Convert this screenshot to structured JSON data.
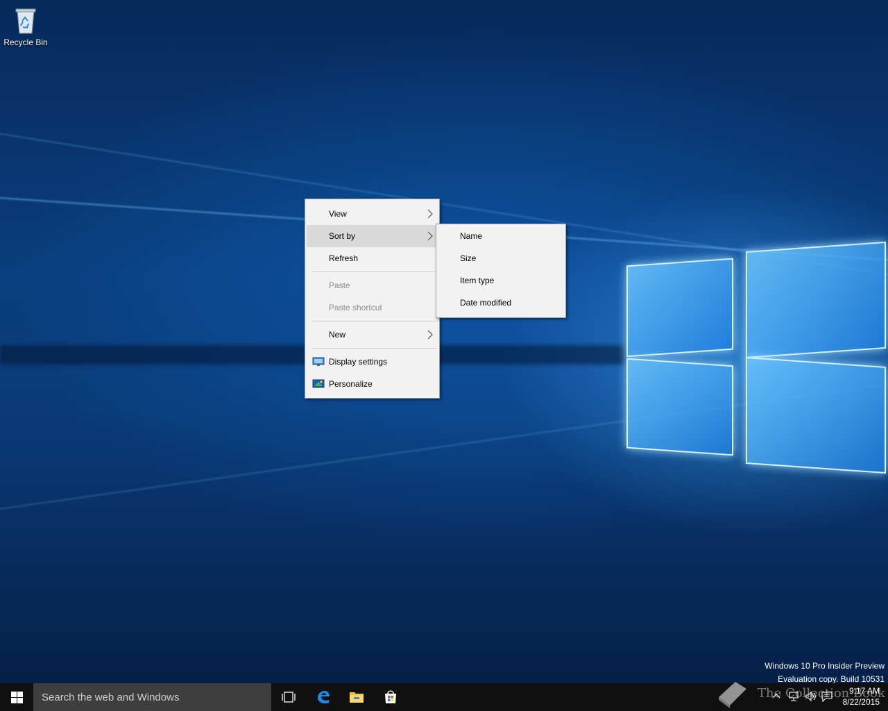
{
  "desktop": {
    "icons": [
      {
        "label": "Recycle Bin",
        "icon": "recycle-bin-icon"
      }
    ]
  },
  "context_menu": {
    "items": [
      {
        "label": "View",
        "submenu": true,
        "state": "normal"
      },
      {
        "label": "Sort by",
        "submenu": true,
        "state": "highlighted"
      },
      {
        "label": "Refresh",
        "submenu": false,
        "state": "normal"
      },
      {
        "label": "Paste",
        "submenu": false,
        "state": "disabled"
      },
      {
        "label": "Paste shortcut",
        "submenu": false,
        "state": "disabled"
      },
      {
        "label": "New",
        "submenu": true,
        "state": "normal"
      },
      {
        "label": "Display settings",
        "icon": "display-settings-icon",
        "state": "normal"
      },
      {
        "label": "Personalize",
        "icon": "personalize-icon",
        "state": "normal"
      }
    ]
  },
  "sort_submenu": {
    "items": [
      {
        "label": "Name"
      },
      {
        "label": "Size"
      },
      {
        "label": "Item type"
      },
      {
        "label": "Date modified"
      }
    ]
  },
  "watermark": {
    "line1": "Windows 10 Pro Insider Preview",
    "line2": "Evaluation copy. Build 10531"
  },
  "taskbar": {
    "search_placeholder": "Search the web and Windows",
    "pinned": [
      "task-view-icon",
      "edge-icon",
      "file-explorer-icon",
      "store-icon"
    ],
    "clock": {
      "time": "9:17 AM",
      "date": "8/22/2015"
    },
    "tray_icons": [
      "chevron-up-icon",
      "network-icon",
      "volume-icon",
      "action-center-icon"
    ]
  },
  "overlay_watermark": {
    "text": "The Collection Book"
  },
  "colors": {
    "taskbar": "#101010",
    "search_box": "#3e3e3e",
    "menu_bg": "#f2f2f2",
    "menu_highlight": "#d9d9d9",
    "disabled_text": "#8c8c8c"
  }
}
